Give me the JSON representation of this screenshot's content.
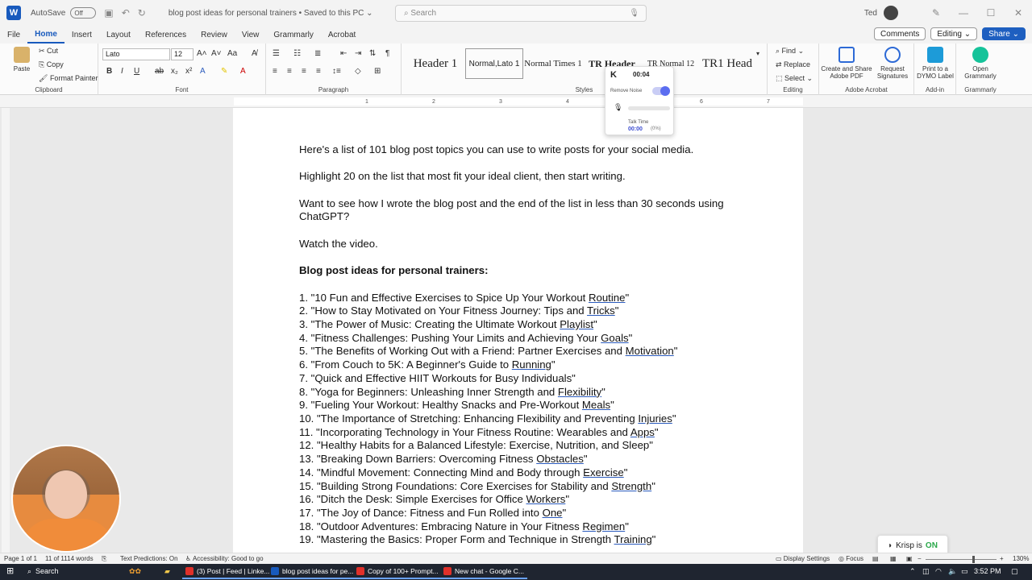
{
  "titlebar": {
    "autosave_label": "AutoSave",
    "autosave_state": "Off",
    "doc_title": "blog post ideas for personal trainers  •  Saved to this PC  ⌄",
    "search_placeholder": "Search",
    "user": "Ted"
  },
  "tabs": [
    "File",
    "Home",
    "Insert",
    "Layout",
    "References",
    "Review",
    "View",
    "Grammarly",
    "Acrobat"
  ],
  "active_tab": "Home",
  "tab_actions": {
    "comments": "Comments",
    "editing": "Editing",
    "share": "Share"
  },
  "ribbon": {
    "clipboard": {
      "paste": "Paste",
      "cut": "Cut",
      "copy": "Copy",
      "format_painter": "Format Painter",
      "label": "Clipboard"
    },
    "font": {
      "name": "Lato",
      "size": "12",
      "label": "Font"
    },
    "paragraph": {
      "label": "Paragraph"
    },
    "styles": {
      "label": "Styles",
      "items": [
        "Header 1",
        "Normal,Lato 1",
        "Normal Times 1",
        "TR Header",
        "TR Normal 12",
        "TR1 Head"
      ]
    },
    "editing": {
      "find": "Find",
      "replace": "Replace",
      "select": "Select",
      "label": "Editing"
    },
    "acrobat": {
      "create": "Create and Share Adobe PDF",
      "request": "Request Signatures",
      "label": "Adobe Acrobat"
    },
    "addin": {
      "print": "Print to a DYMO Label",
      "label": "Add-in"
    },
    "grammarly": {
      "open": "Open Grammarly",
      "label": "Grammarly"
    }
  },
  "ruler_ticks": [
    "1",
    "2",
    "3",
    "4",
    "5",
    "6",
    "7"
  ],
  "document": {
    "intro": [
      "Here's a list of 101 blog post topics you can use to write posts for your social media.",
      "Highlight 20 on the list that most fit your ideal client, then start writing.",
      "Want to see how I wrote the blog post and the end of the list in less than 30 seconds using ChatGPT?",
      "Watch the video."
    ],
    "heading": "Blog post ideas for personal trainers:",
    "items": [
      {
        "text": "1. \"10 Fun and Effective Exercises to Spice Up Your Workout ",
        "ul": "Routine",
        "end": "\""
      },
      {
        "text": "2. \"How to Stay Motivated on Your Fitness Journey: Tips and ",
        "ul": "Tricks",
        "end": "\""
      },
      {
        "text": "3. \"The Power of Music: Creating the Ultimate Workout ",
        "ul": "Playlist",
        "end": "\""
      },
      {
        "text": "4. \"Fitness Challenges: Pushing Your Limits and Achieving Your ",
        "ul": "Goals",
        "end": "\""
      },
      {
        "text": "5. \"The Benefits of Working Out with a Friend: Partner Exercises and ",
        "ul": "Motivation",
        "end": "\""
      },
      {
        "text": "6. \"From Couch to 5K: A Beginner's Guide to ",
        "ul": "Running",
        "end": "\""
      },
      {
        "text": "7. \"Quick and Effective HIIT Workouts for Busy Individuals\"",
        "ul": "",
        "end": ""
      },
      {
        "text": "8. \"Yoga for Beginners: Unleashing Inner Strength and ",
        "ul": "Flexibility",
        "end": "\""
      },
      {
        "text": "9. \"Fueling Your Workout: Healthy Snacks and Pre-Workout ",
        "ul": "Meals",
        "end": "\""
      },
      {
        "text": "10. \"The Importance of Stretching: Enhancing Flexibility and Preventing ",
        "ul": "Injuries",
        "end": "\""
      },
      {
        "text": "11. \"Incorporating Technology in Your Fitness Routine: Wearables and ",
        "ul": "Apps",
        "end": "\""
      },
      {
        "text": "12. \"Healthy Habits for a Balanced Lifestyle: Exercise, Nutrition, and Sleep\"",
        "ul": "",
        "end": ""
      },
      {
        "text": "13. \"Breaking Down Barriers: Overcoming Fitness ",
        "ul": "Obstacles",
        "end": "\""
      },
      {
        "text": "14. \"Mindful Movement: Connecting Mind and Body through ",
        "ul": "Exercise",
        "end": "\""
      },
      {
        "text": "15. \"Building Strong Foundations: Core Exercises for Stability and ",
        "ul": "Strength",
        "end": "\""
      },
      {
        "text": "16. \"Ditch the Desk: Simple Exercises for Office ",
        "ul": "Workers",
        "end": "\""
      },
      {
        "text": "17. \"The Joy of Dance: Fitness and Fun Rolled into ",
        "ul": "One",
        "end": "\""
      },
      {
        "text": "18. \"Outdoor Adventures: Embracing Nature in Your Fitness ",
        "ul": "Regimen",
        "end": "\""
      },
      {
        "text": "19. \"Mastering the Basics: Proper Form and Technique in Strength ",
        "ul": "Training",
        "end": "\""
      }
    ]
  },
  "krisp": {
    "time": "00:04",
    "remove_noise": "Remove Noise",
    "talk_time_label": "Talk Time",
    "talk_time": "00:00",
    "percent": "(0%)",
    "status_label": "Krisp is",
    "status_value": "ON"
  },
  "statusbar": {
    "page": "Page 1 of 1",
    "words": "11 of 1114 words",
    "predictions": "Text Predictions: On",
    "accessibility": "Accessibility: Good to go",
    "display": "Display Settings",
    "focus": "Focus",
    "zoom": "130%"
  },
  "taskbar": {
    "search": "Search",
    "apps": [
      "(3) Post | Feed | Linke...",
      "blog post ideas for pe...",
      "Copy of 100+ Prompt...",
      "New chat - Google C..."
    ],
    "time": "3:52 PM"
  },
  "colors": {
    "accent": "#185abd",
    "share": "#1e5fc0",
    "krisp_on": "#2aa84a"
  }
}
